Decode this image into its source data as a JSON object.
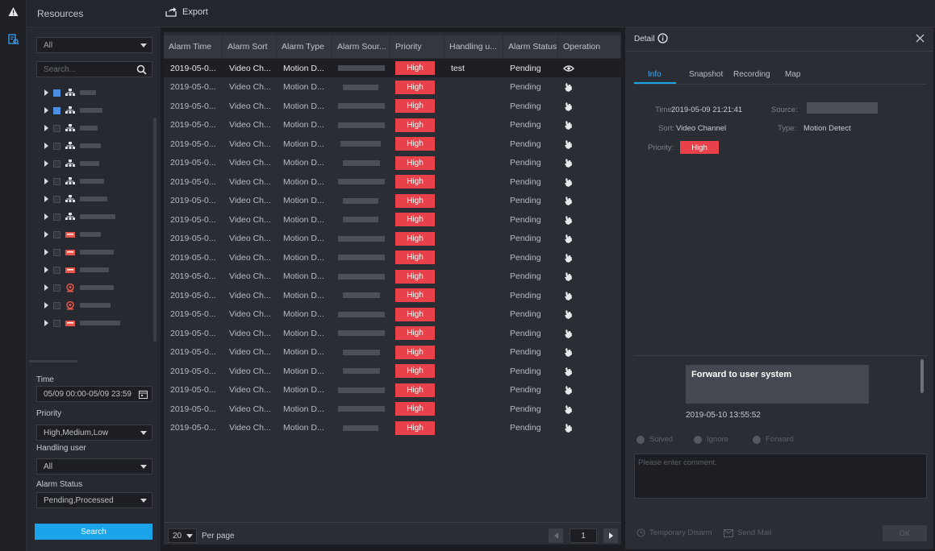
{
  "sidebar_title": "Resources",
  "toolbar": {
    "export_label": "Export"
  },
  "filter": {
    "org_select": "All",
    "search_placeholder": "Search...",
    "time_label": "Time",
    "time_value": "05/09 00:00-05/09 23:59",
    "priority_label": "Priority",
    "priority_value": "High,Medium,Low",
    "handling_label": "Handling user",
    "handling_value": "All",
    "status_label": "Alarm Status",
    "status_value": "Pending,Processed",
    "search_button": "Search"
  },
  "tree": [
    {
      "icon": "device-tree-icon",
      "checked": true
    },
    {
      "icon": "device-tree-icon",
      "checked": true
    },
    {
      "icon": "device-tree-icon",
      "checked": false
    },
    {
      "icon": "device-tree-icon",
      "checked": false
    },
    {
      "icon": "device-tree-icon",
      "checked": false
    },
    {
      "icon": "device-tree-icon",
      "checked": false
    },
    {
      "icon": "device-tree-icon",
      "checked": false
    },
    {
      "icon": "device-tree-icon",
      "checked": false
    },
    {
      "icon": "nvr-icon",
      "checked": false
    },
    {
      "icon": "nvr-icon",
      "checked": false
    },
    {
      "icon": "nvr-icon",
      "checked": false
    },
    {
      "icon": "camera-icon",
      "checked": false
    },
    {
      "icon": "camera-icon",
      "checked": false
    },
    {
      "icon": "nvr-icon",
      "checked": false
    }
  ],
  "table": {
    "columns": [
      "Alarm Time",
      "Alarm Sort",
      "Alarm Type",
      "Alarm Sour...",
      "Priority",
      "Handling u...",
      "Alarm Status",
      "Operation"
    ],
    "rows": [
      {
        "time": "2019-05-0...",
        "sort": "Video Ch...",
        "type": "Motion D...",
        "priority": "High",
        "handler": "test",
        "status": "Pending",
        "op": "view-icon"
      },
      {
        "time": "2019-05-0...",
        "sort": "Video Ch...",
        "type": "Motion D...",
        "priority": "High",
        "handler": "",
        "status": "Pending",
        "op": "hand-icon"
      },
      {
        "time": "2019-05-0...",
        "sort": "Video Ch...",
        "type": "Motion D...",
        "priority": "High",
        "handler": "",
        "status": "Pending",
        "op": "hand-icon"
      },
      {
        "time": "2019-05-0...",
        "sort": "Video Ch...",
        "type": "Motion D...",
        "priority": "High",
        "handler": "",
        "status": "Pending",
        "op": "hand-icon"
      },
      {
        "time": "2019-05-0...",
        "sort": "Video Ch...",
        "type": "Motion D...",
        "priority": "High",
        "handler": "",
        "status": "Pending",
        "op": "hand-icon"
      },
      {
        "time": "2019-05-0...",
        "sort": "Video Ch...",
        "type": "Motion D...",
        "priority": "High",
        "handler": "",
        "status": "Pending",
        "op": "hand-icon"
      },
      {
        "time": "2019-05-0...",
        "sort": "Video Ch...",
        "type": "Motion D...",
        "priority": "High",
        "handler": "",
        "status": "Pending",
        "op": "hand-icon"
      },
      {
        "time": "2019-05-0...",
        "sort": "Video Ch...",
        "type": "Motion D...",
        "priority": "High",
        "handler": "",
        "status": "Pending",
        "op": "hand-icon"
      },
      {
        "time": "2019-05-0...",
        "sort": "Video Ch...",
        "type": "Motion D...",
        "priority": "High",
        "handler": "",
        "status": "Pending",
        "op": "hand-icon"
      },
      {
        "time": "2019-05-0...",
        "sort": "Video Ch...",
        "type": "Motion D...",
        "priority": "High",
        "handler": "",
        "status": "Pending",
        "op": "hand-icon"
      },
      {
        "time": "2019-05-0...",
        "sort": "Video Ch...",
        "type": "Motion D...",
        "priority": "High",
        "handler": "",
        "status": "Pending",
        "op": "hand-icon"
      },
      {
        "time": "2019-05-0...",
        "sort": "Video Ch...",
        "type": "Motion D...",
        "priority": "High",
        "handler": "",
        "status": "Pending",
        "op": "hand-icon"
      },
      {
        "time": "2019-05-0...",
        "sort": "Video Ch...",
        "type": "Motion D...",
        "priority": "High",
        "handler": "",
        "status": "Pending",
        "op": "hand-icon"
      },
      {
        "time": "2019-05-0...",
        "sort": "Video Ch...",
        "type": "Motion D...",
        "priority": "High",
        "handler": "",
        "status": "Pending",
        "op": "hand-icon"
      },
      {
        "time": "2019-05-0...",
        "sort": "Video Ch...",
        "type": "Motion D...",
        "priority": "High",
        "handler": "",
        "status": "Pending",
        "op": "hand-icon"
      },
      {
        "time": "2019-05-0...",
        "sort": "Video Ch...",
        "type": "Motion D...",
        "priority": "High",
        "handler": "",
        "status": "Pending",
        "op": "hand-icon"
      },
      {
        "time": "2019-05-0...",
        "sort": "Video Ch...",
        "type": "Motion D...",
        "priority": "High",
        "handler": "",
        "status": "Pending",
        "op": "hand-icon"
      },
      {
        "time": "2019-05-0...",
        "sort": "Video Ch...",
        "type": "Motion D...",
        "priority": "High",
        "handler": "",
        "status": "Pending",
        "op": "hand-icon"
      },
      {
        "time": "2019-05-0...",
        "sort": "Video Ch...",
        "type": "Motion D...",
        "priority": "High",
        "handler": "",
        "status": "Pending",
        "op": "hand-icon"
      },
      {
        "time": "2019-05-0...",
        "sort": "Video Ch...",
        "type": "Motion D...",
        "priority": "High",
        "handler": "",
        "status": "Pending",
        "op": "hand-icon"
      }
    ]
  },
  "pagination": {
    "per_page_value": "20",
    "per_page_label": "Per page",
    "current_page": "1"
  },
  "detail": {
    "title": "Detail",
    "tabs": [
      "Info",
      "Snapshot",
      "Recording",
      "Map"
    ],
    "time_label": "Time:",
    "time_value": "2019-05-09 21:21:41",
    "source_label": "Source:",
    "sort_label": "Sort:",
    "sort_value": "Video Channel",
    "type_label": "Type:",
    "type_value": "Motion Detect",
    "priority_label": "Priority:",
    "priority_value": "High",
    "forward_message": "Forward to user system",
    "forward_time": "2019-05-10 13:55:52",
    "options": [
      "Solved",
      "Ignore",
      "Forward"
    ],
    "comment_placeholder": "Please enter comment.",
    "temp_disarm": "Temporary Disarm",
    "send_mail": "Send Mail",
    "ok": "OK"
  },
  "colors": {
    "accent": "#1aa3e8",
    "priority_high": "#e94149",
    "checkbox_on": "#4b8ee3"
  }
}
